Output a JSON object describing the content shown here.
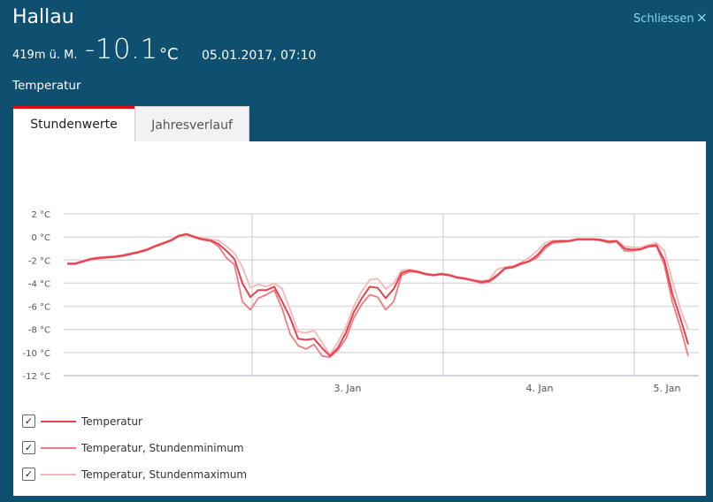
{
  "header": {
    "station": "Hallau",
    "altitude": "419m ü. M.",
    "value": "-10.1",
    "unit": "°C",
    "datetime": "05.01.2017, 07:10",
    "parameter": "Temperatur",
    "close_label": "Schliessen",
    "close_icon": "×"
  },
  "tabs": [
    {
      "label": "Stundenwerte",
      "active": true
    },
    {
      "label": "Jahresverlauf",
      "active": false
    }
  ],
  "colors": {
    "header_bg": "#0f4f70",
    "accent": "#e30613",
    "temp": "#e5424d",
    "min": "#f07a80",
    "max": "#f8b5b8"
  },
  "chart_data": {
    "type": "line",
    "ylim": [
      -12,
      2
    ],
    "y_ticks": [
      "2 °C",
      "0 °C",
      "-2 °C",
      "-4 °C",
      "-6 °C",
      "-8 °C",
      "-10 °C",
      "-12 °C"
    ],
    "x_ticks": [
      "3. Jan",
      "4. Jan",
      "5. Jan"
    ],
    "x_unit": "hour",
    "series": [
      {
        "name": "Temperatur",
        "values": [
          -2.3,
          -2.3,
          -2.1,
          -1.9,
          -1.8,
          -1.75,
          -1.7,
          -1.6,
          -1.45,
          -1.3,
          -1.1,
          -0.8,
          -0.55,
          -0.3,
          0.1,
          0.25,
          0.0,
          -0.2,
          -0.3,
          -0.6,
          -1.2,
          -1.9,
          -4.0,
          -5.2,
          -4.6,
          -4.6,
          -4.3,
          -5.6,
          -7.0,
          -8.8,
          -8.9,
          -8.8,
          -9.6,
          -10.3,
          -9.6,
          -8.3,
          -6.5,
          -5.3,
          -4.3,
          -4.4,
          -5.3,
          -4.5,
          -3.1,
          -2.9,
          -3.0,
          -3.2,
          -3.3,
          -3.2,
          -3.3,
          -3.5,
          -3.6,
          -3.75,
          -3.9,
          -3.8,
          -3.3,
          -2.7,
          -2.6,
          -2.3,
          -2.1,
          -1.6,
          -0.8,
          -0.4,
          -0.35,
          -0.35,
          -0.2,
          -0.2,
          -0.2,
          -0.25,
          -0.4,
          -0.35,
          -1.0,
          -1.1,
          -1.05,
          -0.8,
          -0.7,
          -2.0,
          -4.9,
          -7.0,
          -9.3
        ]
      },
      {
        "name": "Temperatur, Stundenminimum",
        "values": [
          -2.35,
          -2.35,
          -2.15,
          -1.95,
          -1.85,
          -1.8,
          -1.75,
          -1.65,
          -1.5,
          -1.35,
          -1.15,
          -0.85,
          -0.6,
          -0.35,
          0.05,
          0.2,
          -0.05,
          -0.25,
          -0.35,
          -0.8,
          -1.8,
          -2.4,
          -5.6,
          -6.3,
          -5.3,
          -5.0,
          -4.6,
          -6.2,
          -8.4,
          -9.4,
          -9.7,
          -9.3,
          -10.3,
          -10.4,
          -9.8,
          -8.8,
          -7.0,
          -5.8,
          -5.0,
          -5.2,
          -6.3,
          -5.6,
          -3.3,
          -3.0,
          -3.05,
          -3.25,
          -3.35,
          -3.25,
          -3.35,
          -3.55,
          -3.65,
          -3.8,
          -4.0,
          -3.9,
          -3.4,
          -2.75,
          -2.65,
          -2.35,
          -2.15,
          -1.8,
          -1.0,
          -0.5,
          -0.45,
          -0.4,
          -0.25,
          -0.25,
          -0.25,
          -0.3,
          -0.5,
          -0.4,
          -1.2,
          -1.2,
          -1.1,
          -0.85,
          -0.8,
          -2.4,
          -5.6,
          -7.8,
          -10.3
        ]
      },
      {
        "name": "Temperatur, Stundenmaximum",
        "values": [
          -2.25,
          -2.25,
          -2.05,
          -1.85,
          -1.75,
          -1.7,
          -1.65,
          -1.55,
          -1.4,
          -1.25,
          -1.05,
          -0.75,
          -0.5,
          -0.25,
          0.15,
          0.3,
          0.05,
          -0.1,
          -0.2,
          -0.3,
          -0.8,
          -1.4,
          -2.6,
          -4.4,
          -4.1,
          -4.3,
          -4.0,
          -4.5,
          -6.3,
          -8.2,
          -8.3,
          -8.1,
          -9.1,
          -10.2,
          -9.1,
          -7.8,
          -6.0,
          -4.7,
          -3.7,
          -3.6,
          -4.5,
          -4.0,
          -2.9,
          -2.8,
          -2.95,
          -3.15,
          -3.25,
          -3.15,
          -3.25,
          -3.45,
          -3.55,
          -3.7,
          -3.8,
          -3.7,
          -2.8,
          -2.6,
          -2.5,
          -2.2,
          -1.8,
          -1.2,
          -0.5,
          -0.3,
          -0.3,
          -0.3,
          -0.15,
          -0.15,
          -0.15,
          -0.2,
          -0.35,
          -0.3,
          -0.8,
          -0.9,
          -0.9,
          -0.7,
          -0.5,
          -1.2,
          -3.8,
          -6.2,
          -8.0
        ]
      }
    ]
  },
  "legend": [
    {
      "label": "Temperatur",
      "checked": true
    },
    {
      "label": "Temperatur, Stundenminimum",
      "checked": true
    },
    {
      "label": "Temperatur, Stundenmaximum",
      "checked": true
    }
  ],
  "checkbox_glyph": "✓"
}
